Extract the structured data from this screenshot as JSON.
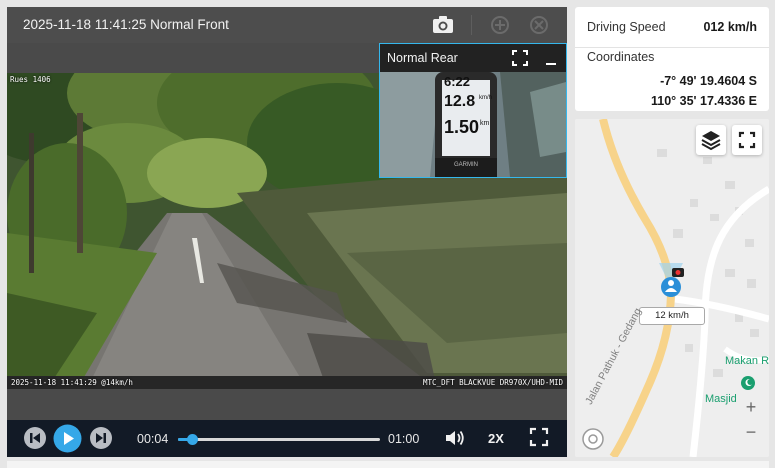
{
  "player": {
    "title": "2025-11-18 11:41:25 Normal Front",
    "icons": [
      "camera-icon",
      "share-icon",
      "remote-icon"
    ],
    "front_osd": {
      "top_left": "Rues 1406",
      "bottom_left": "2025-11-18 11:41:29 @14km/h",
      "bottom_right": "MTC_DFT BLACKVUE DR970X/UHD-MID"
    },
    "rear": {
      "title": "Normal Rear",
      "gauge_time": "6:22",
      "gauge_speed": "12.8",
      "gauge_distance": "1.50",
      "gauge_unit_speed": "km/h",
      "gauge_unit_distance": "km",
      "gauge_brand": "GARMIN"
    },
    "controls": {
      "current_time": "00:04",
      "total_time": "01:00",
      "progress_fraction": 0.067,
      "speed": "2X"
    }
  },
  "info": {
    "speed_label": "Driving Speed",
    "speed_value": "012 km/h",
    "coords_label": "Coordinates",
    "latitude": "-7° 49' 19.4604 S",
    "longitude": "110° 35' 17.4336 E"
  },
  "map": {
    "speed_bubble": "12 km/h",
    "road_label": "Jalan Pathuk - Gedang",
    "poi_1": "Makan R",
    "poi_2": "Masjid",
    "zoom_in": "+",
    "zoom_out": "−"
  },
  "colors": {
    "accent": "#35a8e8",
    "player_bg": "#4d4d4d",
    "control_bar": "#121a26",
    "map_road": "#f7d38a",
    "poi_green": "#1a9f6f"
  }
}
